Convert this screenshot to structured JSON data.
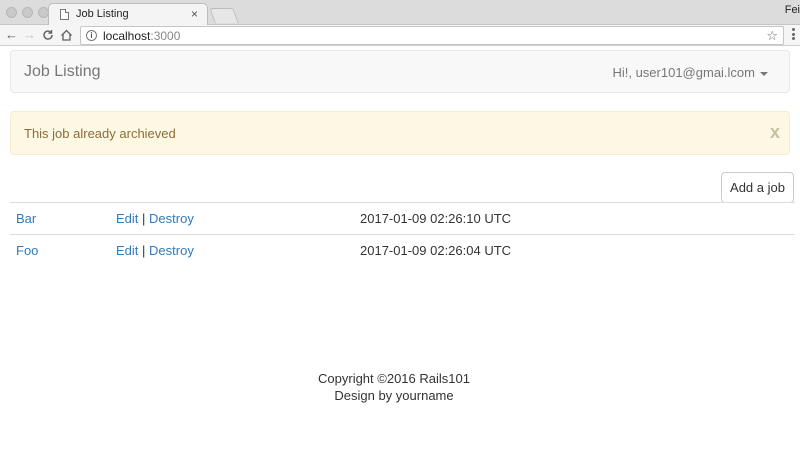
{
  "browser": {
    "tab_title": "Job Listing",
    "tab_close": "×",
    "profile_name": "Fei",
    "url_host": "localhost",
    "url_port": ":3000",
    "icons": {
      "back": "arrow-left-icon",
      "forward": "arrow-right-icon",
      "reload": "reload-icon",
      "home": "home-icon",
      "info": "info-icon",
      "star": "star-icon",
      "menu": "kebab-menu-icon"
    }
  },
  "navbar": {
    "brand": "Job Listing",
    "user_label": "Hi!, user101@gmai.lcom"
  },
  "alert": {
    "message": "This job already archieved",
    "close": "x"
  },
  "actions": {
    "add_job": "Add a job"
  },
  "jobs": [
    {
      "title": "Bar",
      "edit": "Edit",
      "separator": "|",
      "destroy": "Destroy",
      "created_at": "2017-01-09 02:26:10 UTC"
    },
    {
      "title": "Foo",
      "edit": "Edit",
      "separator": "|",
      "destroy": "Destroy",
      "created_at": "2017-01-09 02:26:04 UTC"
    }
  ],
  "footer": {
    "copyright": "Copyright ©2016 Rails101",
    "design": "Design by yourname"
  },
  "colors": {
    "link": "#337ab7",
    "alert_bg": "#fcf8e3",
    "alert_text": "#8a6d3b",
    "navbar_bg": "#f8f8f8"
  }
}
